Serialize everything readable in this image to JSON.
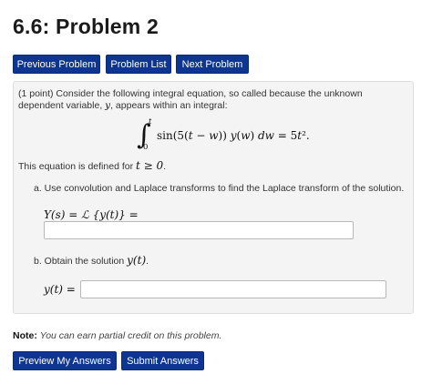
{
  "page": {
    "title": "6.6: Problem 2"
  },
  "nav": {
    "previous_label": "Previous Problem",
    "list_label": "Problem List",
    "next_label": "Next Problem"
  },
  "problem": {
    "intro": "(1 point) Consider the following integral equation, so called because the unknown dependent variable, ",
    "intro_var": "y",
    "intro_end": ", appears within an integral:",
    "integral": {
      "upper": "t",
      "lower": "0",
      "body": "sin(5(t − w)) y(w) dw = 5t².",
      "body_parts": [
        "sin(5(",
        "t",
        " − ",
        "w",
        ")) ",
        "y",
        "(",
        "w",
        ") ",
        "dw",
        " = 5",
        "t",
        "²."
      ]
    },
    "domain_prefix": "This equation is defined for ",
    "domain_math": "t ≥ 0",
    "domain_suffix": ".",
    "part_a": {
      "text": "a. Use convolution and Laplace transforms to find the Laplace transform of the solution.",
      "label": "Y(s) = ℒ {y(t)} =",
      "value": ""
    },
    "part_b": {
      "text_prefix": "b. Obtain the solution ",
      "text_math": "y(t)",
      "text_suffix": ".",
      "label": "y(t) =",
      "value": ""
    }
  },
  "note": {
    "label": "Note:",
    "text": "You can earn partial credit on this problem."
  },
  "actions": {
    "preview_label": "Preview My Answers",
    "submit_label": "Submit Answers"
  },
  "colors": {
    "button": "#0e3590",
    "panel": "#f4f4f4"
  }
}
